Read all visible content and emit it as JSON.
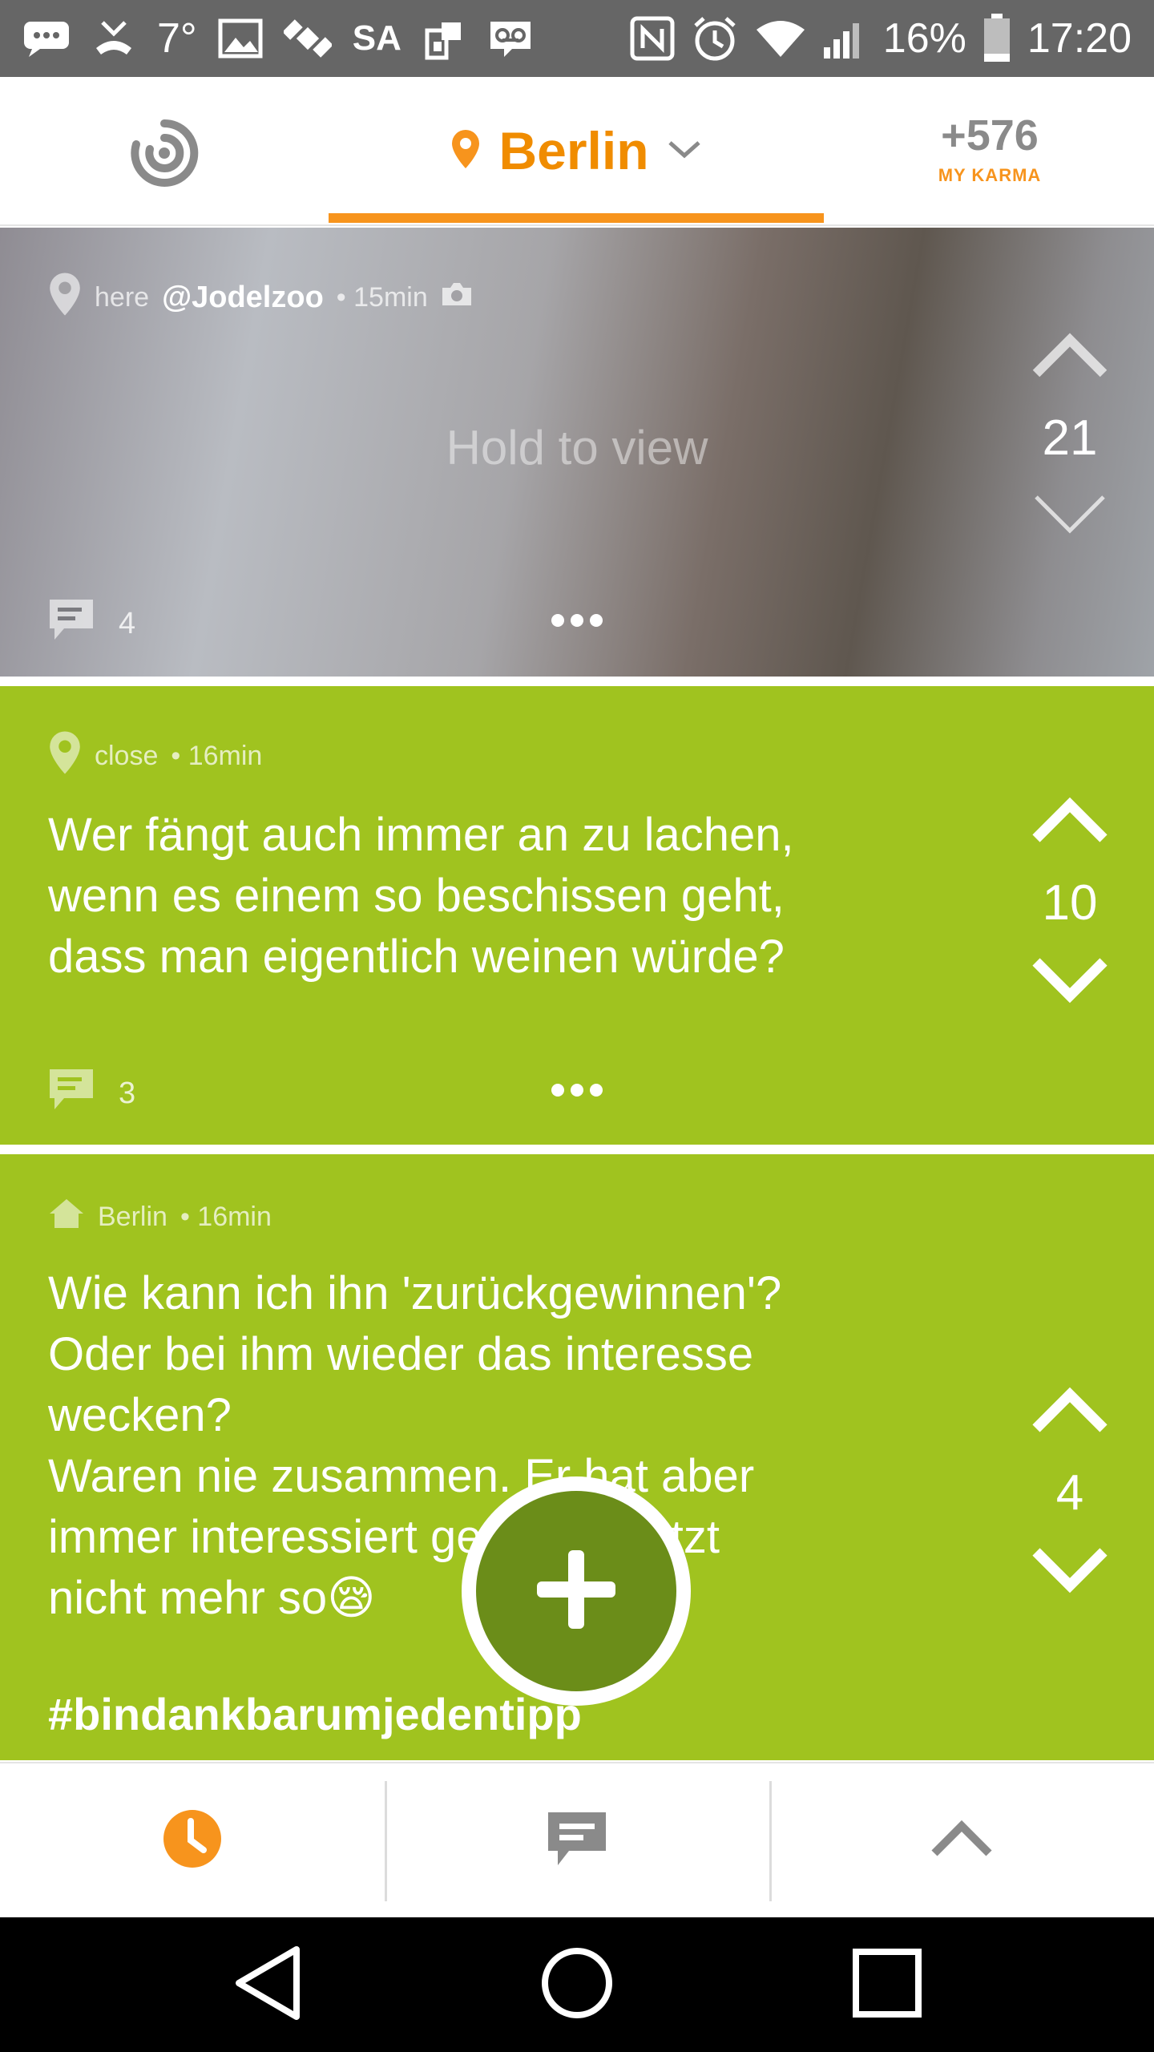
{
  "status_bar": {
    "temperature": "7°",
    "carrier": "SA",
    "battery": "16%",
    "time": "17:20"
  },
  "header": {
    "location": "Berlin",
    "karma_value": "+576",
    "karma_label": "MY KARMA"
  },
  "posts": [
    {
      "distance": "here",
      "author": "@Jodelzoo",
      "time": "• 15min",
      "media_hint": "Hold to view",
      "votes": "21",
      "comments": "4"
    },
    {
      "distance": "close",
      "time": "• 16min",
      "text": "Wer fängt auch immer an zu lachen,\nwenn es einem so beschissen geht,\ndass man eigentlich weinen würde?",
      "votes": "10",
      "comments": "3"
    },
    {
      "distance": "Berlin",
      "time": "• 16min",
      "text": "Wie kann ich ihn 'zurückgewinnen'?\nOder bei ihm wieder das interesse\nwecken?\nWaren nie zusammen. Er hat aber\nimmer interessiert gewirkt & jetzt\nnicht mehr so😪",
      "hashtag": "#bindankbarumjedentipp",
      "votes": "4"
    }
  ],
  "colors": {
    "accent": "#f7941d",
    "post_green": "#a0c31f",
    "fab_green": "#6b8d19"
  },
  "icons": {
    "tabs": [
      "clock-icon",
      "chat-icon",
      "chevron-up-icon"
    ],
    "nav": [
      "back-icon",
      "home-icon",
      "recents-icon"
    ]
  }
}
